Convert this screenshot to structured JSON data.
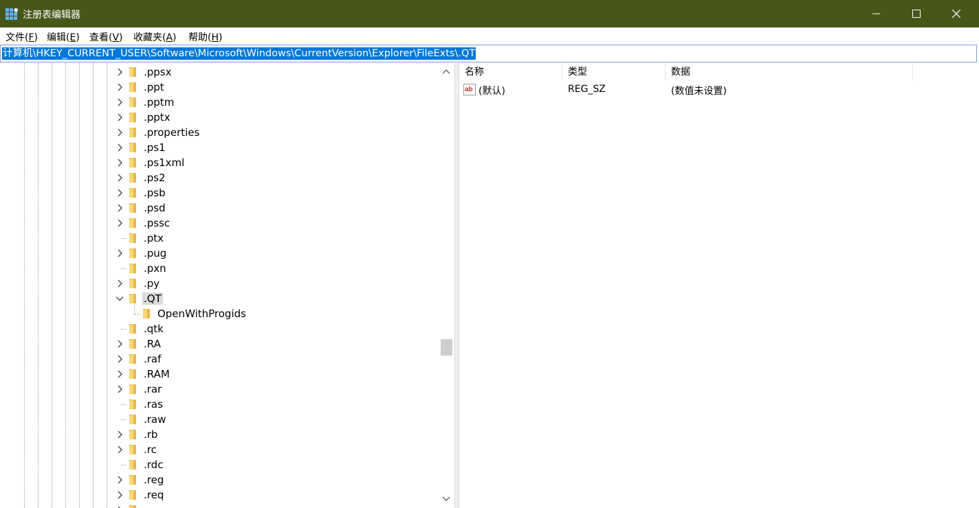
{
  "window": {
    "title": "注册表编辑器",
    "accent": "#475719"
  },
  "menu": [
    {
      "label": "文件(",
      "key": "F",
      "suffix": ")"
    },
    {
      "label": "编辑(",
      "key": "E",
      "suffix": ")"
    },
    {
      "label": "查看(",
      "key": "V",
      "suffix": ")"
    },
    {
      "label": "收藏夹(",
      "key": "A",
      "suffix": ")"
    },
    {
      "label": "帮助(",
      "key": "H",
      "suffix": ")"
    }
  ],
  "address": {
    "path": "计算机\\HKEY_CURRENT_USER\\Software\\Microsoft\\Windows\\CurrentVersion\\Explorer\\FileExts\\.QT",
    "selection_color": "#0078d7"
  },
  "tree": {
    "items": [
      {
        "label": ".ppsx",
        "expander": "collapsed",
        "level": 0,
        "selected": false
      },
      {
        "label": ".ppt",
        "expander": "collapsed",
        "level": 0,
        "selected": false
      },
      {
        "label": ".pptm",
        "expander": "collapsed",
        "level": 0,
        "selected": false
      },
      {
        "label": ".pptx",
        "expander": "collapsed",
        "level": 0,
        "selected": false
      },
      {
        "label": ".properties",
        "expander": "collapsed",
        "level": 0,
        "selected": false
      },
      {
        "label": ".ps1",
        "expander": "collapsed",
        "level": 0,
        "selected": false
      },
      {
        "label": ".ps1xml",
        "expander": "collapsed",
        "level": 0,
        "selected": false
      },
      {
        "label": ".ps2",
        "expander": "collapsed",
        "level": 0,
        "selected": false
      },
      {
        "label": ".psb",
        "expander": "collapsed",
        "level": 0,
        "selected": false
      },
      {
        "label": ".psd",
        "expander": "collapsed",
        "level": 0,
        "selected": false
      },
      {
        "label": ".pssc",
        "expander": "collapsed",
        "level": 0,
        "selected": false
      },
      {
        "label": ".ptx",
        "expander": "none",
        "level": 0,
        "selected": false
      },
      {
        "label": ".pug",
        "expander": "collapsed",
        "level": 0,
        "selected": false
      },
      {
        "label": ".pxn",
        "expander": "none",
        "level": 0,
        "selected": false
      },
      {
        "label": ".py",
        "expander": "collapsed",
        "level": 0,
        "selected": false
      },
      {
        "label": ".QT",
        "expander": "expanded",
        "level": 0,
        "selected": true
      },
      {
        "label": "OpenWithProgids",
        "expander": "none",
        "level": 1,
        "selected": false
      },
      {
        "label": ".qtk",
        "expander": "none",
        "level": 0,
        "selected": false
      },
      {
        "label": ".RA",
        "expander": "collapsed",
        "level": 0,
        "selected": false
      },
      {
        "label": ".raf",
        "expander": "collapsed",
        "level": 0,
        "selected": false
      },
      {
        "label": ".RAM",
        "expander": "collapsed",
        "level": 0,
        "selected": false
      },
      {
        "label": ".rar",
        "expander": "collapsed",
        "level": 0,
        "selected": false
      },
      {
        "label": ".ras",
        "expander": "none",
        "level": 0,
        "selected": false
      },
      {
        "label": ".raw",
        "expander": "none",
        "level": 0,
        "selected": false
      },
      {
        "label": ".rb",
        "expander": "collapsed",
        "level": 0,
        "selected": false
      },
      {
        "label": ".rc",
        "expander": "collapsed",
        "level": 0,
        "selected": false
      },
      {
        "label": ".rdc",
        "expander": "none",
        "level": 0,
        "selected": false
      },
      {
        "label": ".reg",
        "expander": "collapsed",
        "level": 0,
        "selected": false
      },
      {
        "label": ".req",
        "expander": "collapsed",
        "level": 0,
        "selected": false
      },
      {
        "label": "",
        "expander": "collapsed",
        "level": 0,
        "selected": false
      }
    ]
  },
  "values": {
    "headers": [
      "名称",
      "类型",
      "数据"
    ],
    "rows": [
      {
        "icon": "string-value-icon",
        "name": "(默认)",
        "type": "REG_SZ",
        "data": "(数值未设置)"
      }
    ]
  },
  "icons": {
    "app": "registry-editor-icon",
    "folder": "folder-icon",
    "folder_color": "#f8d775",
    "expand": "chevron-right-icon",
    "collapse": "chevron-down-icon"
  }
}
